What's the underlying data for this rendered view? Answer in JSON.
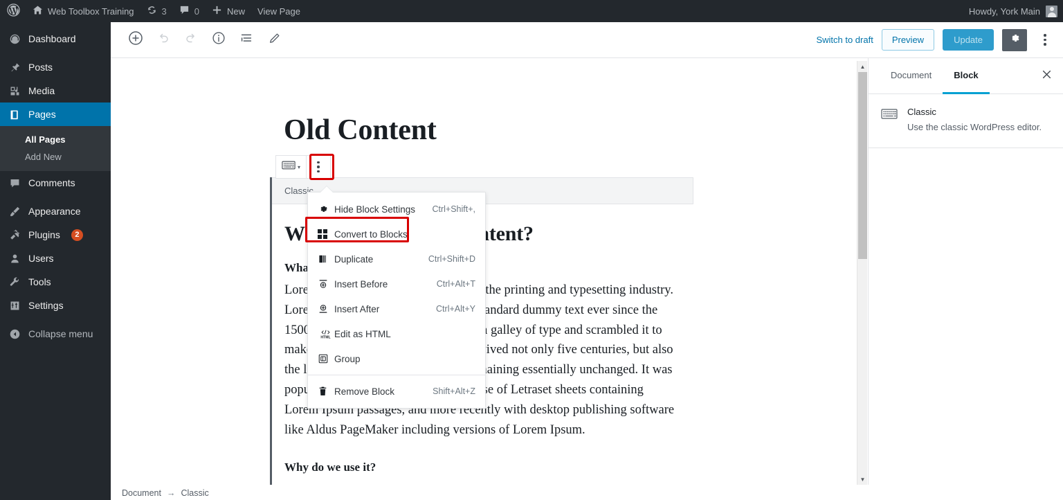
{
  "adminbar": {
    "logo_icon": "wordpress-logo-icon",
    "site_icon": "home-icon",
    "site_name": "Web Toolbox Training",
    "updates_icon": "updates-icon",
    "updates_count": "3",
    "comments_icon": "comment-icon",
    "comments_count": "0",
    "new_icon": "plus-icon",
    "new_label": "New",
    "view_page_label": "View Page",
    "howdy": "Howdy, York Main",
    "avatar_icon": "user-avatar"
  },
  "adminmenu": {
    "items": [
      {
        "label": "Dashboard",
        "icon": "dashboard-icon",
        "current": false
      },
      {
        "label": "Posts",
        "icon": "pin-icon",
        "current": false
      },
      {
        "label": "Media",
        "icon": "media-icon",
        "current": false
      },
      {
        "label": "Pages",
        "icon": "pages-icon",
        "current": true
      },
      {
        "label": "Comments",
        "icon": "comment-icon",
        "current": false
      },
      {
        "label": "Appearance",
        "icon": "brush-icon",
        "current": false
      },
      {
        "label": "Plugins",
        "icon": "plugin-icon",
        "current": false,
        "badge": "2"
      },
      {
        "label": "Users",
        "icon": "user-icon",
        "current": false
      },
      {
        "label": "Tools",
        "icon": "wrench-icon",
        "current": false
      },
      {
        "label": "Settings",
        "icon": "settings-icon",
        "current": false
      },
      {
        "label": "Collapse menu",
        "icon": "collapse-icon",
        "current": false
      }
    ],
    "submenu": [
      {
        "label": "All Pages",
        "current": true
      },
      {
        "label": "Add New",
        "current": false
      }
    ]
  },
  "editor_header": {
    "add_block_icon": "plus-circle-icon",
    "undo_icon": "undo-icon",
    "redo_icon": "redo-icon",
    "info_icon": "info-circle-icon",
    "list_view_icon": "list-view-icon",
    "edit_icon": "pencil-icon",
    "switch_to_draft": "Switch to draft",
    "preview": "Preview",
    "update": "Update",
    "settings_icon": "gear-icon",
    "more_icon": "more-vertical-icon"
  },
  "canvas": {
    "page_title": "Old Content",
    "block_name": "Classic",
    "heading": "What about my old content?",
    "subheading": "What is Lorem Ipsum?",
    "paragraph": "Lorem Ipsum is simply dummy text of the printing and typesetting industry. Lorem Ipsum has been the industry's standard dummy text ever since the 1500s, when an unknown printer took a galley of type and scrambled it to make a type specimen book. It has survived not only five centuries, but also the leap into electronic typesetting, remaining essentially unchanged. It was popularised in the 1960s with the release of Letraset sheets containing Lorem Ipsum passages, and more recently with desktop publishing software like Aldus PageMaker including versions of Lorem Ipsum.",
    "second_heading": "Why do we use it?"
  },
  "block_toolbar": {
    "block_type_icon": "keyboard-icon",
    "chevron_icon": "chevron-down-icon",
    "more_options_icon": "more-vertical-icon",
    "highlight_color": "#d80000"
  },
  "dropdown": {
    "groups": [
      {
        "items": [
          {
            "label": "Hide Block Settings",
            "shortcut": "Ctrl+Shift+,",
            "icon": "gear-icon",
            "highlighted": false
          },
          {
            "label": "Convert to Blocks",
            "shortcut": "",
            "icon": "blocks-grid-icon",
            "highlighted": true
          },
          {
            "label": "Duplicate",
            "shortcut": "Ctrl+Shift+D",
            "icon": "duplicate-icon",
            "highlighted": false
          },
          {
            "label": "Insert Before",
            "shortcut": "Ctrl+Alt+T",
            "icon": "insert-before-icon",
            "highlighted": false
          },
          {
            "label": "Insert After",
            "shortcut": "Ctrl+Alt+Y",
            "icon": "insert-after-icon",
            "highlighted": false
          },
          {
            "label": "Edit as HTML",
            "shortcut": "",
            "icon": "html-icon",
            "highlighted": false
          },
          {
            "label": "Group",
            "shortcut": "",
            "icon": "group-icon",
            "highlighted": false
          }
        ]
      },
      {
        "items": [
          {
            "label": "Remove Block",
            "shortcut": "Shift+Alt+Z",
            "icon": "trash-icon",
            "highlighted": false
          }
        ]
      }
    ]
  },
  "settings_sidebar": {
    "tab_document": "Document",
    "tab_block": "Block",
    "close_icon": "close-icon",
    "block_icon": "keyboard-icon",
    "block_title": "Classic",
    "block_description": "Use the classic WordPress editor."
  },
  "footer": {
    "crumb_document": "Document",
    "crumb_separator": "→",
    "crumb_block": "Classic"
  },
  "colors": {
    "admin_bg": "#23282d",
    "accent_blue": "#0073aa",
    "highlight_red": "#d80000",
    "update_button": "#2e9ccc",
    "badge_orange": "#d54e21"
  }
}
